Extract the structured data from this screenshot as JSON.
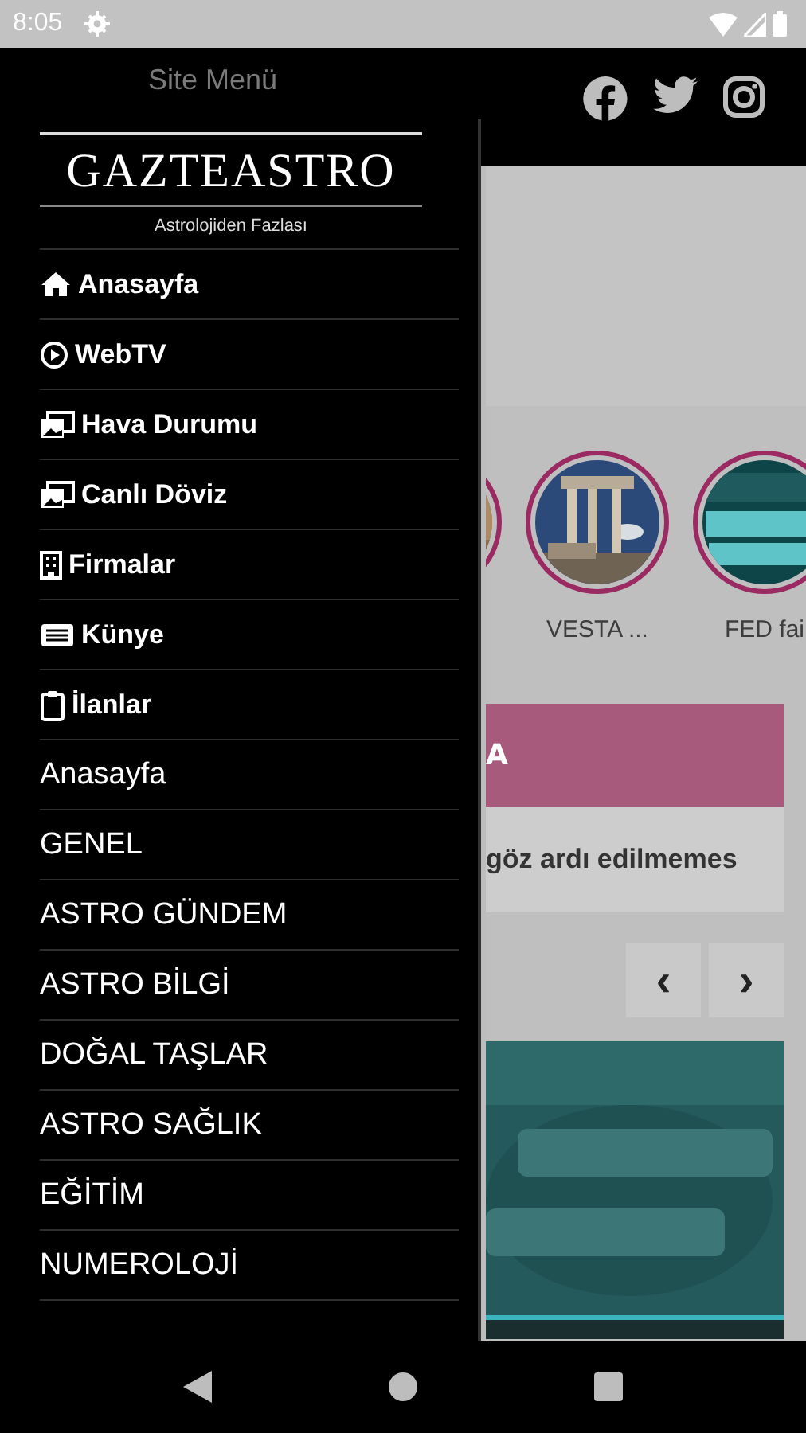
{
  "status_bar": {
    "time": "8:05"
  },
  "header": {
    "title": "Site Menü"
  },
  "drawer": {
    "logo": {
      "title": "GAZTEASTRO",
      "tagline": "Astrolojiden Fazlası"
    },
    "items": [
      {
        "label": "Anasayfa",
        "kind": "icon"
      },
      {
        "label": "WebTV",
        "kind": "icon"
      },
      {
        "label": "Hava Durumu",
        "kind": "icon"
      },
      {
        "label": "Canlı Döviz",
        "kind": "icon"
      },
      {
        "label": "Firmalar",
        "kind": "icon"
      },
      {
        "label": "Künye",
        "kind": "icon"
      },
      {
        "label": "İlanlar",
        "kind": "icon"
      },
      {
        "label": "Anasayfa",
        "kind": "category"
      },
      {
        "label": "GENEL",
        "kind": "category"
      },
      {
        "label": "ASTRO GÜNDEM",
        "kind": "category"
      },
      {
        "label": "ASTRO BİLGİ",
        "kind": "category"
      },
      {
        "label": "DOĞAL TAŞLAR",
        "kind": "category"
      },
      {
        "label": "ASTRO SAĞLIK",
        "kind": "category"
      },
      {
        "label": "EĞİTİM",
        "kind": "category"
      },
      {
        "label": "NUMEROLOJİ",
        "kind": "category"
      }
    ]
  },
  "stories": [
    {
      "kind": "picture"
    },
    {
      "kind": "picture",
      "label": "VESTA ..."
    },
    {
      "kind": "picture",
      "label": "FED fai"
    }
  ],
  "headline": {
    "band": "A",
    "text": "göz ardı edilmemes"
  },
  "pager": {
    "prev": "‹",
    "next": "›"
  }
}
